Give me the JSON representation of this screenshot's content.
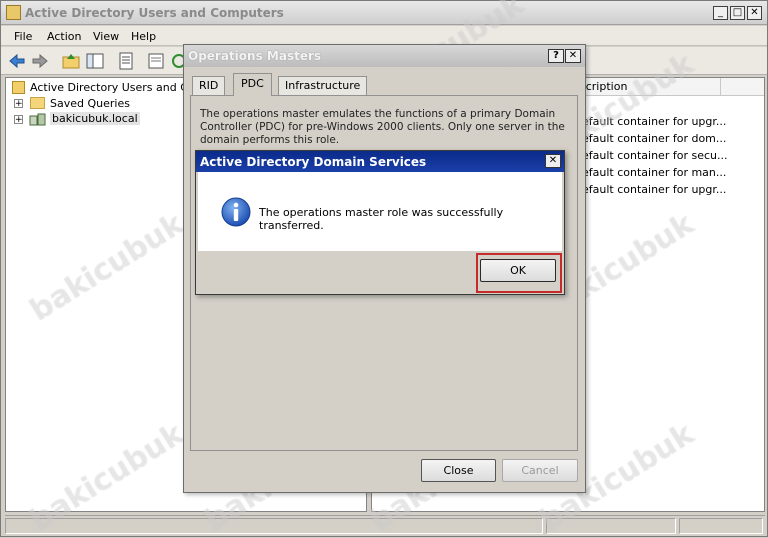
{
  "main_window": {
    "title": "Active Directory Users and Computers",
    "menu": [
      "File",
      "Action",
      "View",
      "Help"
    ],
    "tree": {
      "root": "Active Directory Users and Com",
      "items": [
        {
          "label": "Saved Queries"
        },
        {
          "label": "bakicubuk.local"
        }
      ]
    },
    "list": {
      "header_description": "scription",
      "rows": [
        "efault container for upgr...",
        "efault container for dom...",
        "efault container for secu...",
        "efault container for man...",
        "efault container for upgr..."
      ]
    }
  },
  "ops_dialog": {
    "title": "Operations Masters",
    "help_btn": "?",
    "close_btn": "✕",
    "tabs": [
      {
        "label": "RID"
      },
      {
        "label": "PDC",
        "active": true
      },
      {
        "label": "Infrastructure"
      }
    ],
    "description": "The operations master emulates the functions of a primary Domain Controller (PDC) for pre-Windows 2000 clients. Only one server in the domain performs this role.",
    "close_label": "Close",
    "cancel_label": "Cancel"
  },
  "message_box": {
    "title": "Active Directory Domain Services",
    "close_btn": "✕",
    "message": "The operations master role was successfully transferred.",
    "ok_label": "OK",
    "icon": "info-icon"
  },
  "watermark": "bakicubuk",
  "colors": {
    "msg_titlebar": "#0b2b8a",
    "highlight": "#c62b2b"
  }
}
